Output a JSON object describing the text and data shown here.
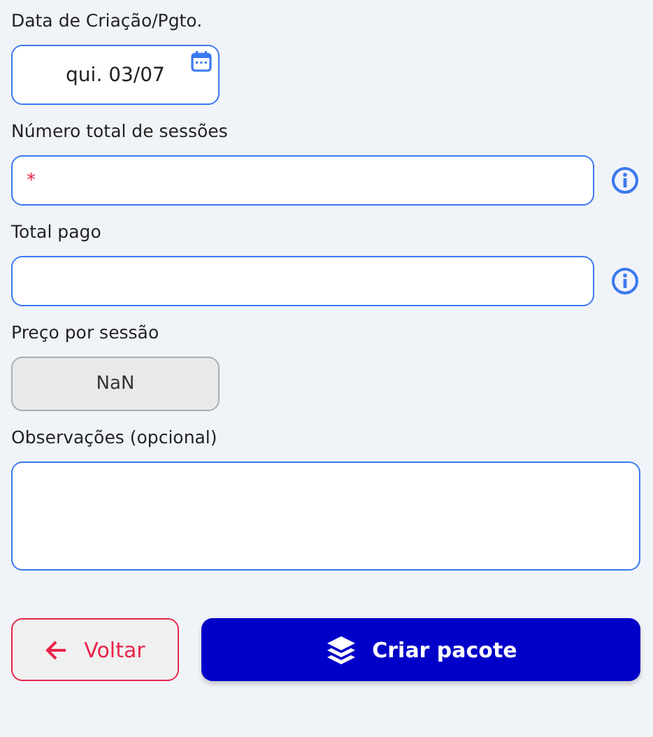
{
  "fields": [
    {
      "kind": "date",
      "label": "Data de Criação/Pgto.",
      "value": "qui. 03/07"
    },
    {
      "kind": "input",
      "label": "Número total de sessões",
      "placeholder": "*",
      "info": true
    },
    {
      "kind": "input",
      "label": "Total pago",
      "info": true
    },
    {
      "kind": "readonly",
      "label": "Preço por sessão",
      "value": "NaN"
    },
    {
      "kind": "textarea",
      "label": "Observações (opcional)"
    }
  ],
  "buttons": [
    {
      "kind": "back",
      "label": "Voltar"
    },
    {
      "kind": "primary",
      "label": "Criar pacote"
    }
  ]
}
